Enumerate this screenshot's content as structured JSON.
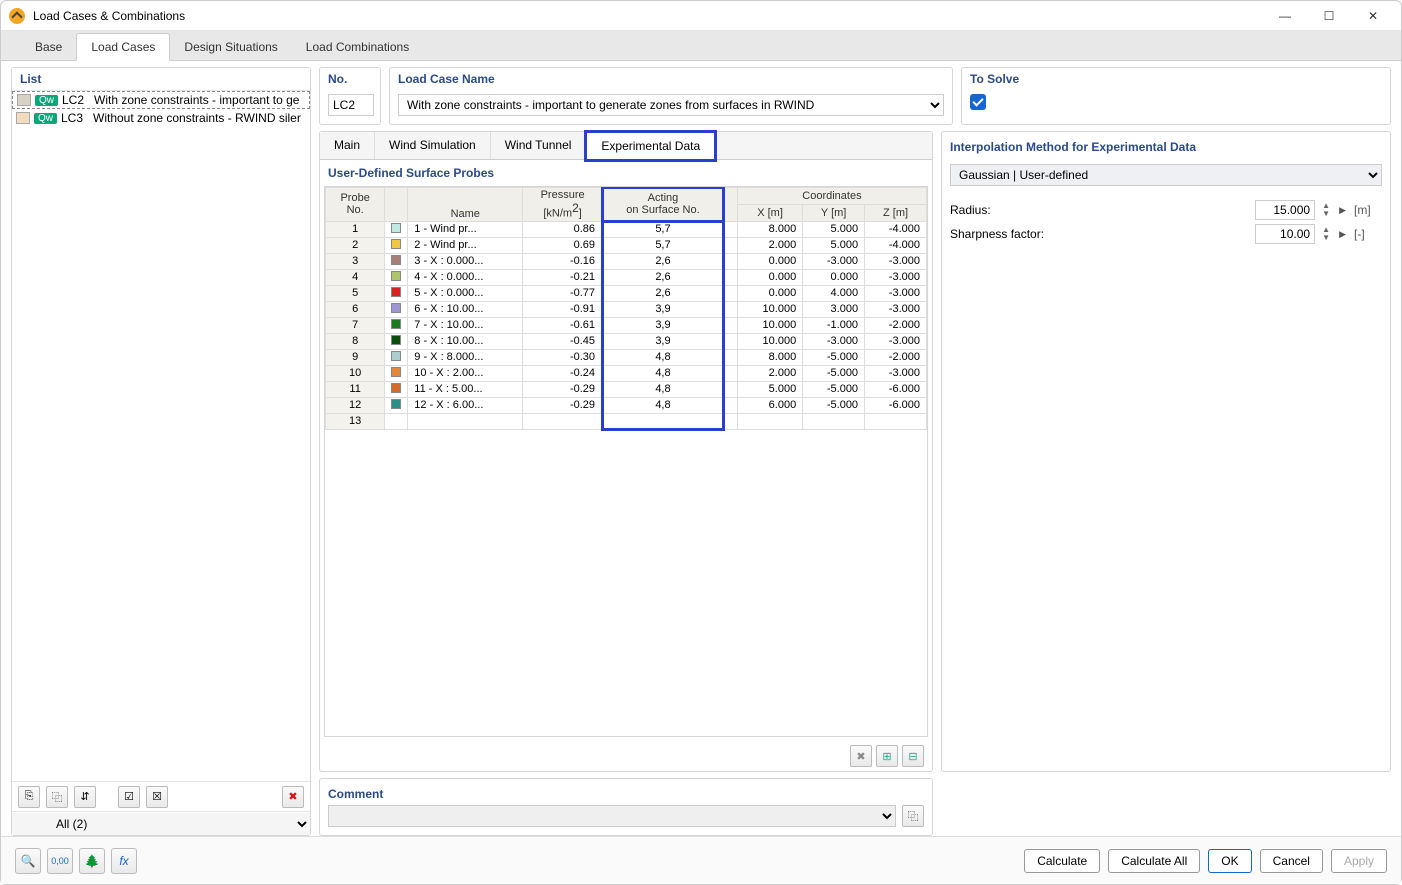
{
  "window": {
    "title": "Load Cases & Combinations"
  },
  "winButtons": {
    "min": "—",
    "max": "☐",
    "close": "✕"
  },
  "topTabs": [
    "Base",
    "Load Cases",
    "Design Situations",
    "Load Combinations"
  ],
  "topTabActive": 1,
  "leftPane": {
    "header": "List",
    "items": [
      {
        "id": "LC2",
        "tag": "Qw",
        "swatch": "#d9d2c2",
        "name": "With zone constraints - important to ge",
        "selected": true
      },
      {
        "id": "LC3",
        "tag": "Qw",
        "swatch": "#f2dcc0",
        "name": "Without zone constraints - RWIND siler",
        "selected": false
      }
    ],
    "toolbar": {
      "new": "⎘",
      "copy": "⿻",
      "sort": "⇵",
      "sel": "☑",
      "desel": "☒",
      "delete": "✖"
    },
    "filter": "All (2)"
  },
  "header": {
    "noLabel": "No.",
    "noValue": "LC2",
    "nameLabel": "Load Case Name",
    "nameValue": "With zone constraints - important to generate zones from surfaces in RWIND",
    "solveLabel": "To Solve"
  },
  "subTabs": [
    "Main",
    "Wind Simulation",
    "Wind Tunnel",
    "Experimental Data"
  ],
  "subTabActive": 3,
  "probes": {
    "header": "User-Defined Surface Probes",
    "columns": {
      "probeNo": "Probe\nNo.",
      "name": "Name",
      "pressure": "Pressure\n[kN/m²]",
      "acting": "Acting\non Surface No.",
      "coordGroup": "Coordinates",
      "x": "X [m]",
      "y": "Y [m]",
      "z": "Z [m]"
    },
    "rows": [
      {
        "n": 1,
        "color": "#bfe9e3",
        "name": "1 - Wind pr...",
        "p": "0.86",
        "s": "5,7",
        "x": "8.000",
        "y": "5.000",
        "z": "-4.000"
      },
      {
        "n": 2,
        "color": "#f2c744",
        "name": "2 - Wind pr...",
        "p": "0.69",
        "s": "5,7",
        "x": "2.000",
        "y": "5.000",
        "z": "-4.000"
      },
      {
        "n": 3,
        "color": "#a87f78",
        "name": "3 - X : 0.000...",
        "p": "-0.16",
        "s": "2,6",
        "x": "0.000",
        "y": "-3.000",
        "z": "-3.000"
      },
      {
        "n": 4,
        "color": "#b0c46c",
        "name": "4 - X : 0.000...",
        "p": "-0.21",
        "s": "2,6",
        "x": "0.000",
        "y": "0.000",
        "z": "-3.000"
      },
      {
        "n": 5,
        "color": "#d92323",
        "name": "5 - X : 0.000...",
        "p": "-0.77",
        "s": "2,6",
        "x": "0.000",
        "y": "4.000",
        "z": "-3.000"
      },
      {
        "n": 6,
        "color": "#9f96d1",
        "name": "6 - X : 10.00...",
        "p": "-0.91",
        "s": "3,9",
        "x": "10.000",
        "y": "3.000",
        "z": "-3.000"
      },
      {
        "n": 7,
        "color": "#1a7a1f",
        "name": "7 - X : 10.00...",
        "p": "-0.61",
        "s": "3,9",
        "x": "10.000",
        "y": "-1.000",
        "z": "-2.000"
      },
      {
        "n": 8,
        "color": "#0b4d0b",
        "name": "8 - X : 10.00...",
        "p": "-0.45",
        "s": "3,9",
        "x": "10.000",
        "y": "-3.000",
        "z": "-3.000"
      },
      {
        "n": 9,
        "color": "#aacfce",
        "name": "9 - X : 8.000...",
        "p": "-0.30",
        "s": "4,8",
        "x": "8.000",
        "y": "-5.000",
        "z": "-2.000"
      },
      {
        "n": 10,
        "color": "#e6883b",
        "name": "10 - X : 2.00...",
        "p": "-0.24",
        "s": "4,8",
        "x": "2.000",
        "y": "-5.000",
        "z": "-3.000"
      },
      {
        "n": 11,
        "color": "#d36b2a",
        "name": "11 - X : 5.00...",
        "p": "-0.29",
        "s": "4,8",
        "x": "5.000",
        "y": "-5.000",
        "z": "-6.000"
      },
      {
        "n": 12,
        "color": "#2a8f86",
        "name": "12 - X : 6.00...",
        "p": "-0.29",
        "s": "4,8",
        "x": "6.000",
        "y": "-5.000",
        "z": "-6.000"
      },
      {
        "n": 13,
        "color": "",
        "name": "",
        "p": "",
        "s": "",
        "x": "",
        "y": "",
        "z": ""
      }
    ],
    "toolbar": {
      "del": "✖",
      "export": "⊞",
      "import": "⊟"
    }
  },
  "interp": {
    "header": "Interpolation Method for Experimental Data",
    "method": "Gaussian | User-defined",
    "radiusLabel": "Radius:",
    "radiusValue": "15.000",
    "radiusUnit": "[m]",
    "sharpLabel": "Sharpness factor:",
    "sharpValue": "10.00",
    "sharpUnit": "[-]"
  },
  "comment": {
    "header": "Comment",
    "value": ""
  },
  "bottom": {
    "icons": {
      "search": "🔍",
      "num": "0,00",
      "tree": "🌲",
      "fx": "fx"
    },
    "calculate": "Calculate",
    "calcAll": "Calculate All",
    "ok": "OK",
    "cancel": "Cancel",
    "apply": "Apply"
  }
}
